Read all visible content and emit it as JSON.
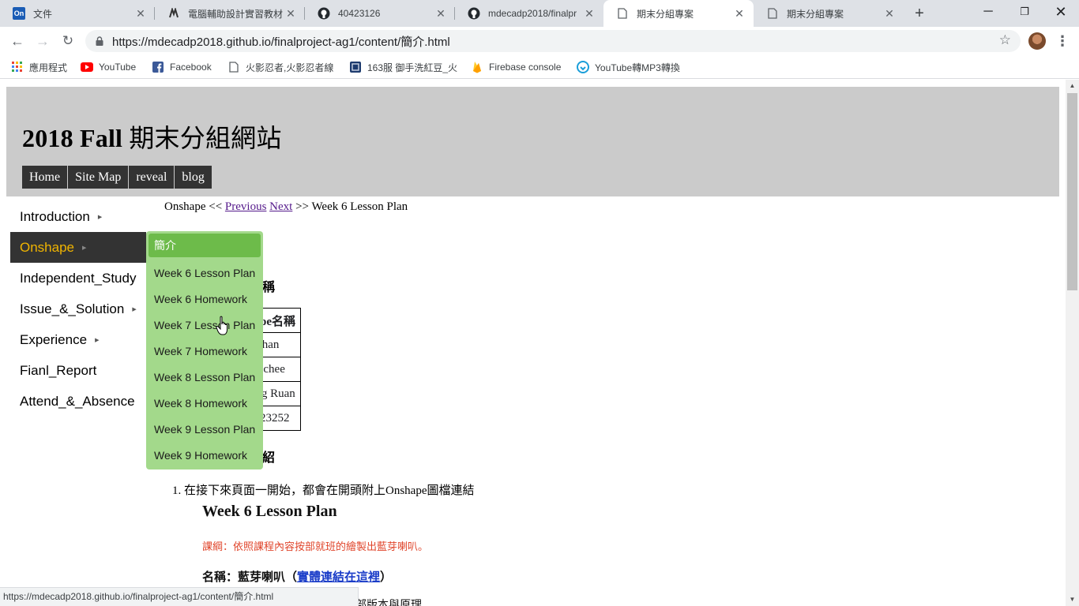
{
  "browser": {
    "tabs": [
      {
        "title": "文件",
        "icon": "onedrive-icon"
      },
      {
        "title": "電腦輔助設計實習教材",
        "icon": "fossil-icon"
      },
      {
        "title": "40423126",
        "icon": "github-icon"
      },
      {
        "title": "mdecadp2018/finalpr",
        "icon": "github-icon"
      },
      {
        "title": "期末分組專案",
        "icon": "page-icon",
        "active": true
      },
      {
        "title": "期末分組專案",
        "icon": "page-icon"
      }
    ],
    "url": "https://mdecadp2018.github.io/finalproject-ag1/content/簡介.html",
    "bookmarks": [
      {
        "label": "應用程式",
        "icon": "apps-grid-icon"
      },
      {
        "label": "YouTube",
        "icon": "youtube-icon"
      },
      {
        "label": "Facebook",
        "icon": "facebook-icon"
      },
      {
        "label": "火影忍者,火影忍者線",
        "icon": "page-icon"
      },
      {
        "label": "163服 御手洗紅豆_火",
        "icon": "game-icon"
      },
      {
        "label": "Firebase console",
        "icon": "firebase-icon"
      },
      {
        "label": "YouTube轉MP3轉換",
        "icon": "converter-icon"
      }
    ],
    "status_url": "https://mdecadp2018.github.io/finalproject-ag1/content/簡介.html"
  },
  "site": {
    "title_bold": "2018 Fall",
    "title_rest": " 期末分組網站",
    "topnav": [
      "Home",
      "Site Map",
      "reveal",
      "blog"
    ],
    "sidemenu": [
      {
        "label": "Introduction",
        "has_sub": true
      },
      {
        "label": "Onshape",
        "has_sub": true,
        "active": true
      },
      {
        "label": "Independent_Study",
        "has_sub": false
      },
      {
        "label": "Issue_&_Solution",
        "has_sub": true
      },
      {
        "label": "Experience",
        "has_sub": true
      },
      {
        "label": "Fianl_Report",
        "has_sub": false
      },
      {
        "label": "Attend_&_Absence",
        "has_sub": false
      }
    ],
    "submenu": [
      "簡介",
      "Week 6 Lesson Plan",
      "Week 6 Homework",
      "Week 7 Lesson Plan",
      "Week 7 Homework",
      "Week 8 Lesson Plan",
      "Week 8 Homework",
      "Week 9 Lesson Plan",
      "Week 9 Homework"
    ],
    "breadcrumb": {
      "prefix": "Onshape << ",
      "prev": "Previous",
      "next": "Next",
      "suffix": " >> Week 6 Lesson Plan"
    },
    "heading_fragment_1": "稱",
    "heading_fragment_2": "紹",
    "members_header": "nshape名稱",
    "members": [
      "ji han",
      "lee chee",
      "Cheng Ruan",
      "40423252"
    ],
    "step_1": "在接下來頁面一開始，都會在開頭附上Onshape圖檔連結",
    "lesson_title": "Week 6 Lesson Plan",
    "outline": "課綱：依照課程內容按部就班的繪製出藍芽喇叭。",
    "name_label": "名稱：藍芽喇叭（",
    "name_link": "實體連結在這裡",
    "name_close": "）",
    "cut_text": "部版本與原理"
  }
}
